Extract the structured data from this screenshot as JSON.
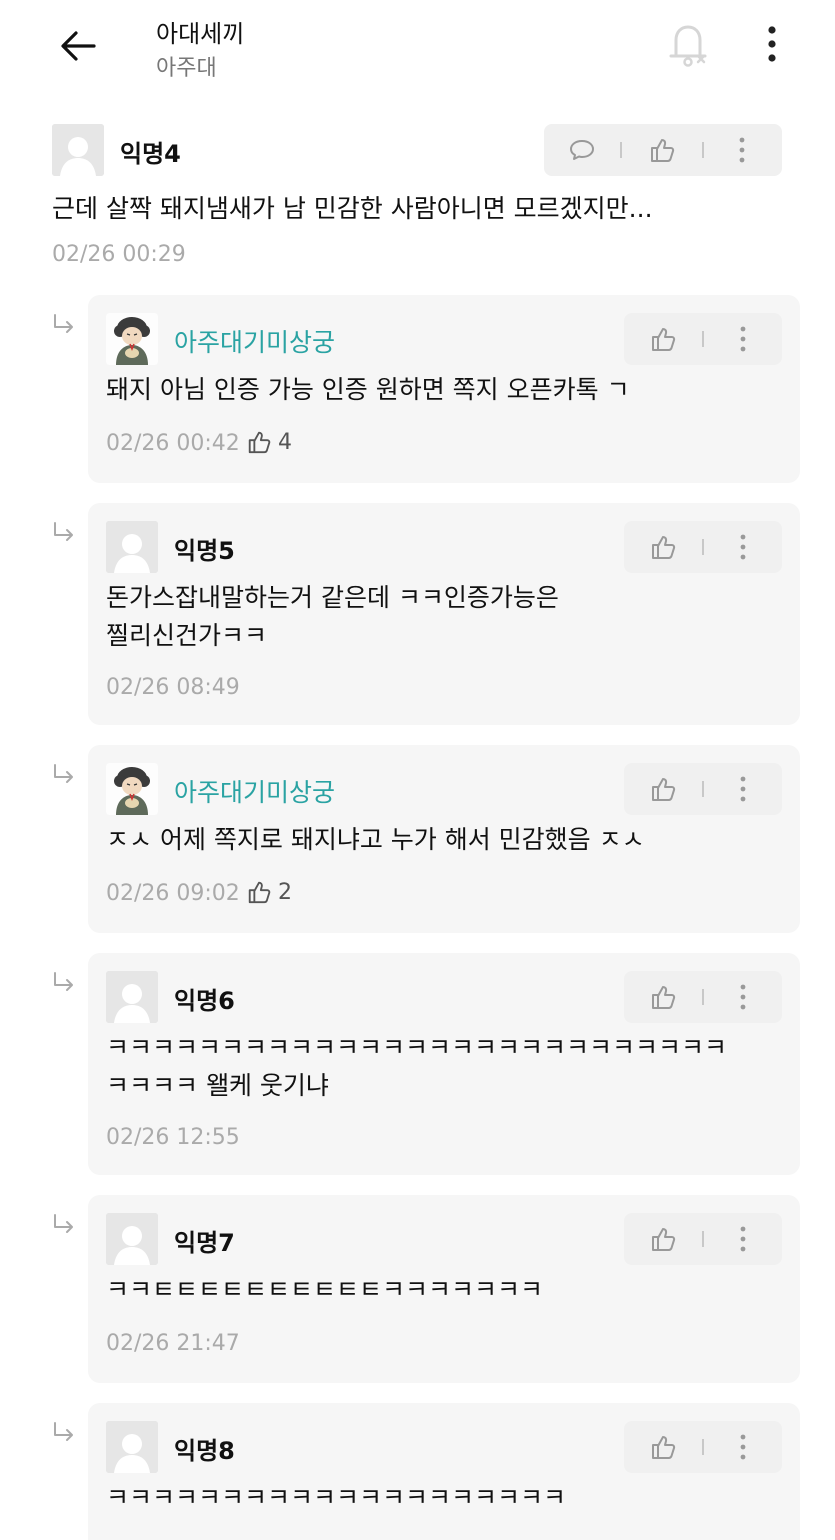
{
  "header": {
    "title": "아대세끼",
    "subtitle": "아주대"
  },
  "colors": {
    "accent": "#2aa3a3",
    "date": "#aaaaaa",
    "reply_bg": "#f6f6f6"
  },
  "top_comment": {
    "author": "익명4",
    "text": "근데 살짝 돼지냄새가 남 민감한 사람아니면 모르겠지만...",
    "date": "02/26 00:29"
  },
  "replies": [
    {
      "author": "아주대기미상궁",
      "text": "돼지 아님 인증 가능 인증 원하면 쪽지 오픈카톡 ㄱ",
      "date": "02/26 00:42",
      "likes": "4"
    },
    {
      "author": "익명5",
      "text": "돈가스잡내말하는거 같은데 ㅋㅋ인증가능은\n찔리신건가ㅋㅋ",
      "date": "02/26 08:49"
    },
    {
      "author": "아주대기미상궁",
      "text": "ㅈㅅ 어제 쪽지로 돼지냐고 누가 해서 민감했음 ㅈㅅ",
      "date": "02/26 09:02",
      "likes": "2"
    },
    {
      "author": "익명6",
      "text": "ㅋㅋㅋㅋㅋㅋㅋㅋㅋㅋㅋㅋㅋㅋㅋㅋㅋㅋㅋㅋㅋㅋㅋㅋㅋㅋㅋ\nㅋㅋㅋㅋ 왤케 웃기냐",
      "date": "02/26 12:55"
    },
    {
      "author": "익명7",
      "text": "ㅋㅋㅌㅌㅌㅌㅌㅌㅌㅌㅌㅌㅋㅋㅋㅋㅋㅋㅋ",
      "date": "02/26 21:47"
    },
    {
      "author": "익명8",
      "text": "ㅋㅋㅋㅋㅋㅋㅋㅋㅋㅋㅋㅋㅋㅋㅋㅋㅋㅋㅋㅋ",
      "date": ""
    }
  ]
}
